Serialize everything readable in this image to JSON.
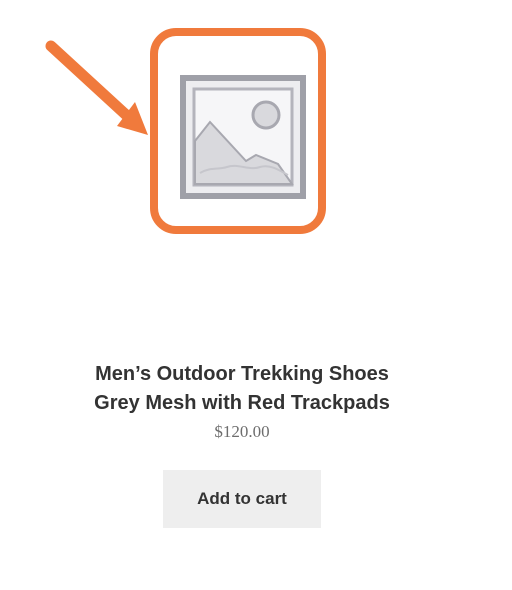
{
  "product": {
    "image": {
      "icon": "image-placeholder-icon",
      "alt": ""
    },
    "title_line1": "Men’s Outdoor Trekking Shoes",
    "title_line2": "Grey Mesh with Red Trackpads",
    "price": "$120.00",
    "add_to_cart_label": "Add to cart"
  },
  "annotation": {
    "arrow_icon": "arrow-icon",
    "highlight_color": "#f07a3c"
  },
  "colors": {
    "placeholder_fill": "#d8d8dc",
    "placeholder_stroke": "#a4a4ac",
    "title_text": "#333333",
    "price_text": "#6d6d6d",
    "button_background": "#eeeeee"
  }
}
